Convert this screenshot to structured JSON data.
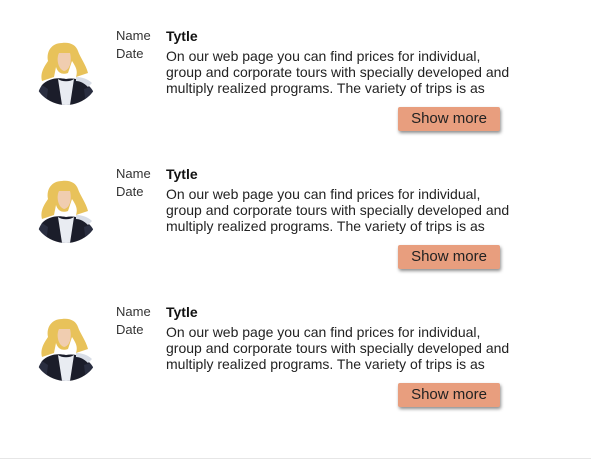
{
  "posts": [
    {
      "name_label": "Name",
      "date_label": "Date",
      "title": "Tytle",
      "text": "On our web page you can find prices for individual, group and corporate tours with specially developed and multiply realized programs. The variety of trips is as diverse as our",
      "button_label": "Show more"
    },
    {
      "name_label": "Name",
      "date_label": "Date",
      "title": "Tytle",
      "text": "On our web page you can find prices for individual, group and corporate tours with specially developed and multiply realized programs. The variety of trips is as diverse as our",
      "button_label": "Show more"
    },
    {
      "name_label": "Name",
      "date_label": "Date",
      "title": "Tytle",
      "text": "On our web page you can find prices for individual, group and corporate tours with specially developed and multiply realized programs. The variety of trips is as diverse as our",
      "button_label": "Show more"
    }
  ],
  "colors": {
    "button": "#e89e7e",
    "text": "#222222"
  }
}
